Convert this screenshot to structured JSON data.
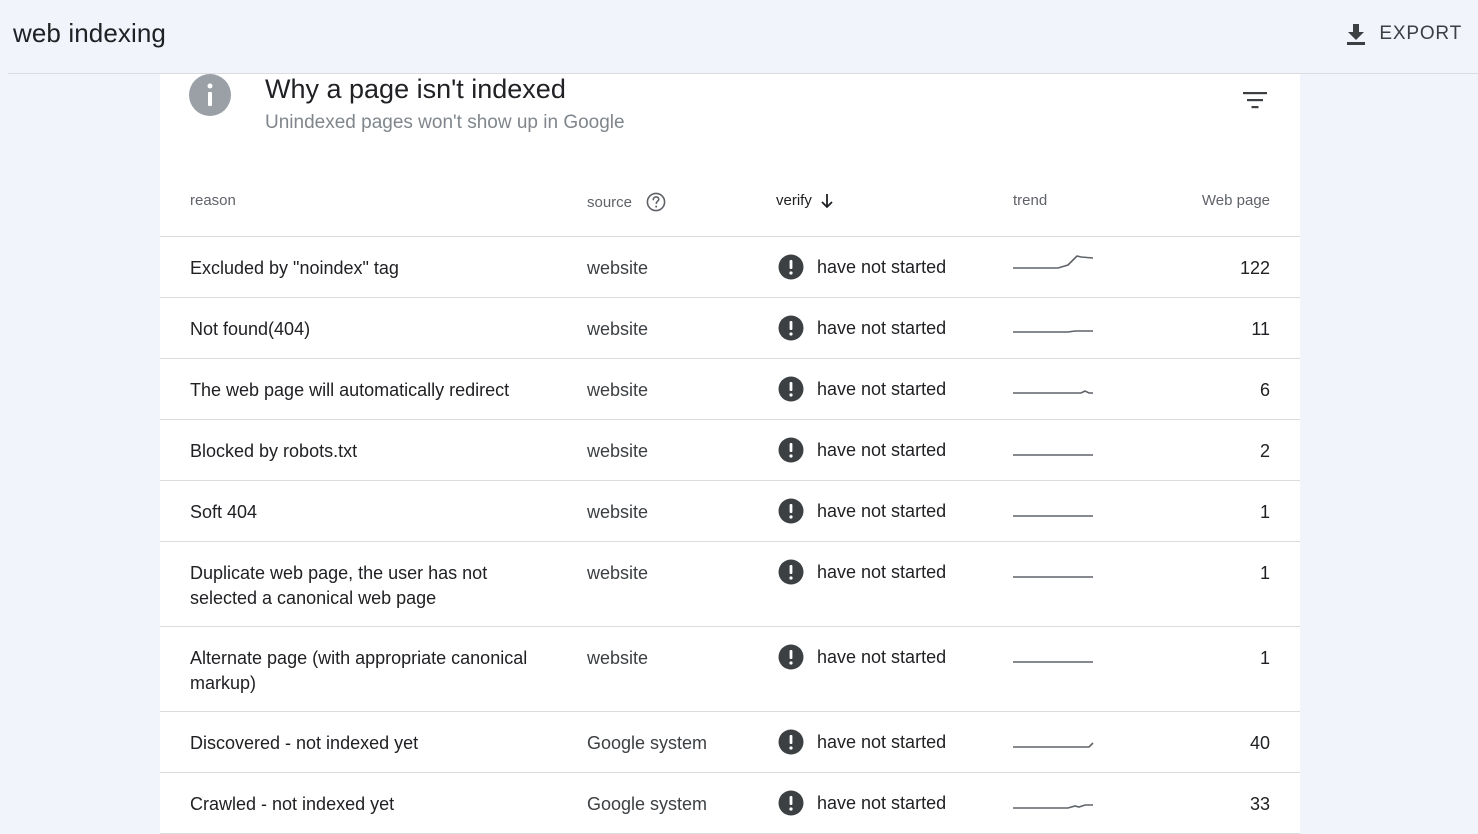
{
  "header": {
    "title": "web indexing",
    "export_label": "EXPORT"
  },
  "card": {
    "title": "Why a page isn't indexed",
    "subtitle": "Unindexed pages won't show up in Google"
  },
  "table": {
    "columns": {
      "reason": "reason",
      "source": "source",
      "verify": "verify",
      "trend": "trend",
      "pages": "Web page"
    },
    "sort": {
      "column": "verify",
      "direction": "descending"
    },
    "rows": [
      {
        "reason": "Excluded by \"noindex\" tag",
        "source": "website",
        "verify": "have not started",
        "pages": "122"
      },
      {
        "reason": "Not found(404)",
        "source": "website",
        "verify": "have not started",
        "pages": "11"
      },
      {
        "reason": "The web page will automatically redirect",
        "source": "website",
        "verify": "have not started",
        "pages": "6"
      },
      {
        "reason": "Blocked by robots.txt",
        "source": "website",
        "verify": "have not started",
        "pages": "2"
      },
      {
        "reason": "Soft 404",
        "source": "website",
        "verify": "have not started",
        "pages": "1"
      },
      {
        "reason": "Duplicate web page, the user has not selected a canonical web page",
        "source": "website",
        "verify": "have not started",
        "pages": "1"
      },
      {
        "reason": "Alternate page (with appropriate canonical markup)",
        "source": "website",
        "verify": "have not started",
        "pages": "1"
      },
      {
        "reason": "Discovered - not indexed yet",
        "source": "Google system",
        "verify": "have not started",
        "pages": "40"
      },
      {
        "reason": "Crawled - not indexed yet",
        "source": "Google system",
        "verify": "have not started",
        "pages": "33"
      }
    ]
  },
  "icons": {
    "export": "download-icon",
    "info": "info-icon",
    "filter": "filter-icon",
    "help": "help-circle-icon",
    "sort": "arrow-down-icon",
    "status": "exclamation-circle-icon"
  },
  "colors": {
    "background": "#f1f4fb",
    "card": "#ffffff",
    "status_icon": "#3c4043",
    "info_icon": "#9aa0a6",
    "trend_line": "#5f6368",
    "divider": "#dadce0"
  }
}
